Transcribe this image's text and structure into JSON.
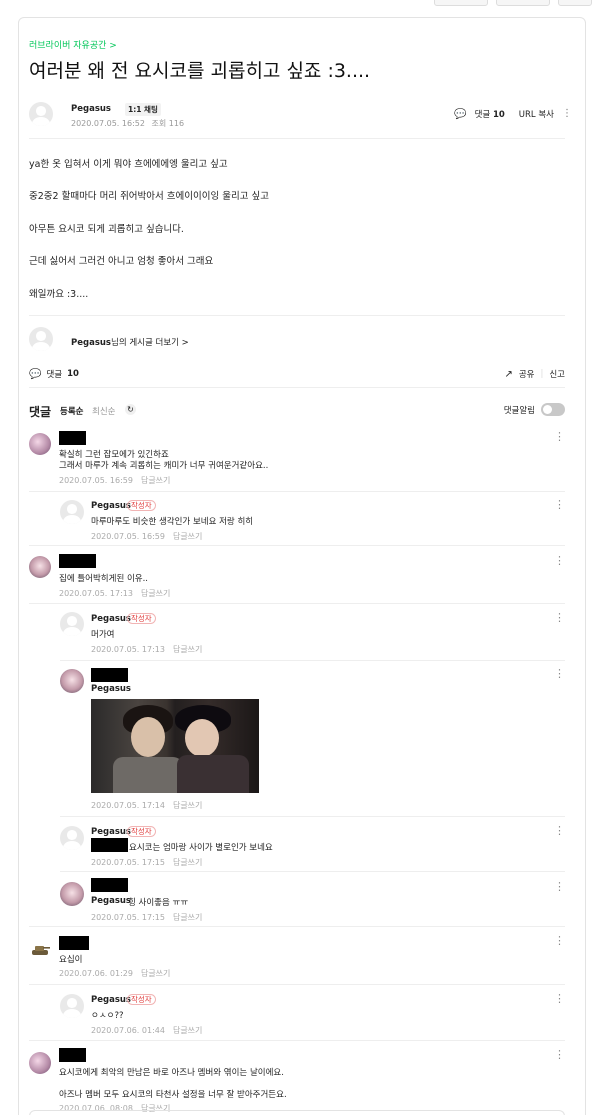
{
  "post": {
    "cafe_link": "러브라이버 자유공간 >",
    "title": "여러분 왜 전 요시코를 괴롭히고 싶죠 :3....",
    "author": "Pegasus",
    "author_badge": "1:1 채팅",
    "date": "2020.07.05. 16:52",
    "views": "조회 116",
    "comment_label": "댓글",
    "comment_count": "10",
    "url_copy": "URL 복사",
    "body": [
      "ya한 옷 입혀서 이게 뭐야 흐에에에엥 울리고 싶고",
      "중2중2 할때마다 머리 쥐어박아서 흐에이이이잉 울리고 싶고",
      "아무튼 요시코 되게 괴롭히고 싶습니다.",
      "근데 싫어서 그러건 아니고 엄청 좋아서 그래요",
      "왜일까요 :3...."
    ],
    "more_author": "Pegasus",
    "more_suffix": "님의 게시글 더보기 >",
    "share": "공유",
    "report": "신고"
  },
  "comments_header": {
    "title": "댓글",
    "sort_registered": "등록순",
    "sort_latest": "최신순",
    "alarm": "댓글알림"
  },
  "reply_label": "답글쓰기",
  "writer_badge": "작성자",
  "comments": [
    {
      "name": "",
      "text": "확실히 그런 잡모에가 있긴하죠",
      "text2": "그래서 마루가 계속 괴롭히는 캐미가 너무 귀여운거같아요..",
      "date": "2020.07.05. 16:59"
    },
    {
      "name": "Pegasus",
      "text": "마루마루도 비슷한 생각인가 보네요 저랑 히히",
      "date": "2020.07.05. 16:59"
    },
    {
      "name": "",
      "text": "집에 틀어박히게된 이유..",
      "date": "2020.07.05. 17:13"
    },
    {
      "name": "Pegasus",
      "text": "머가여",
      "date": "2020.07.05. 17:13"
    },
    {
      "name": "",
      "mention": "Pegasus",
      "text": "",
      "date": "2020.07.05. 17:14"
    },
    {
      "name": "Pegasus",
      "text": "요시코는 엄마랑 사이가 별로인가 보네요",
      "date": "2020.07.05. 17:15"
    },
    {
      "name": "",
      "mention": "Pegasus",
      "text": "힝 사이좋음 ㅠㅠ",
      "date": "2020.07.05. 17:15"
    },
    {
      "name": "",
      "text": "요십이",
      "date": "2020.07.06. 01:29"
    },
    {
      "name": "Pegasus",
      "text": "ㅇㅅㅇ??",
      "date": "2020.07.06. 01:44"
    },
    {
      "name": "",
      "text": "요시코에게 최악의 만남은 바로 아즈나 멤버와 엮이는 날이에요.",
      "text2": "아즈나 멤버 모두 요시코의 타천사 설정을 너무 잘 받아주거든요.",
      "date": "2020.07.06. 08:08"
    }
  ]
}
